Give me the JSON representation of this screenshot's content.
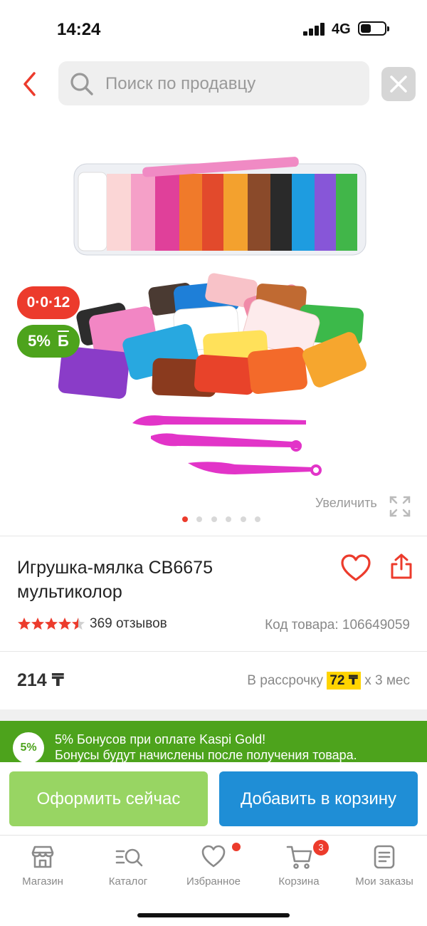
{
  "status_bar": {
    "time": "14:24",
    "network": "4G"
  },
  "search": {
    "placeholder": "Поиск по продавцу"
  },
  "badges": {
    "age": "0·0·12",
    "bonus": "5%",
    "bonus_symbol": "Б"
  },
  "gallery": {
    "zoom_label": "Увеличить",
    "slides": 6,
    "active_slide": 1
  },
  "product": {
    "title_line1": "Игрушка-мялка CB6675",
    "title_line2": "мультиколор",
    "rating": 4.5,
    "reviews": "369 отзывов",
    "sku": "Код товара: 106649059",
    "price": "214 ₸",
    "installment_prefix": "В рассрочку",
    "installment_amount": "72 ₸",
    "installment_suffix": "x 3 мес"
  },
  "bonus_banner": {
    "badge": "5%",
    "line1": "5% Бонусов при оплате Kaspi Gold!",
    "line2": "Бонусы будут начислены после получения товара."
  },
  "actions": {
    "buy_now": "Оформить сейчас",
    "add_to_cart": "Добавить в корзину"
  },
  "tabbar": {
    "items": [
      {
        "label": "Магазин",
        "icon": "store-icon"
      },
      {
        "label": "Каталог",
        "icon": "catalog-search-icon"
      },
      {
        "label": "Избранное",
        "icon": "heart-icon"
      },
      {
        "label": "Корзина",
        "icon": "cart-icon"
      },
      {
        "label": "Мои заказы",
        "icon": "orders-icon"
      }
    ],
    "cart_count": "3"
  },
  "colors": {
    "accent_red": "#ec3b2c",
    "green": "#4da31c",
    "blue": "#1f8ed6",
    "light_green": "#98d563",
    "highlight_yellow": "#ffd400"
  }
}
